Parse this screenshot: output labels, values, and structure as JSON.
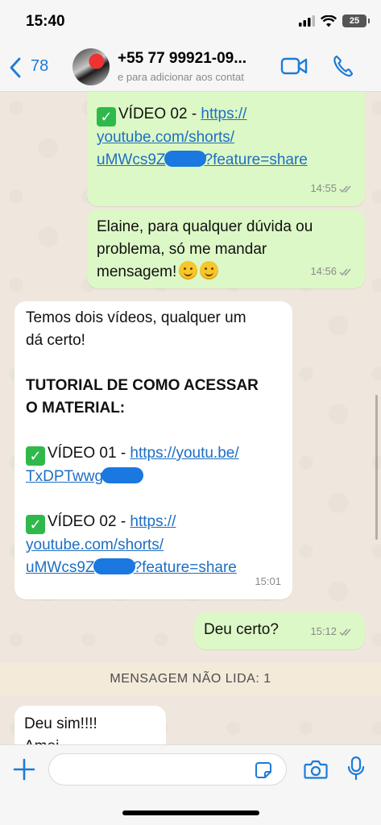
{
  "status_bar": {
    "time": "15:40",
    "battery": "25"
  },
  "header": {
    "back_count": "78",
    "contact_name": "+55 77 99921-09...",
    "contact_subtitle": "e para adicionar aos contat"
  },
  "messages": {
    "m1": {
      "check": "✓",
      "label": "VÍDEO 02 - ",
      "link_a": "https://",
      "link_b": "youtube.com/shorts/",
      "link_c1": "uMWcs9Z",
      "link_c2": "?feature=share",
      "time": "14:55"
    },
    "m2": {
      "line1": "Elaine, para qualquer dúvida ou",
      "line2": "problema, só me mandar",
      "line3": "mensagem!",
      "time": "14:56"
    },
    "m3": {
      "line1": "Temos dois vídeos, qualquer um",
      "line2": "dá certo!",
      "tutorial1": "TUTORIAL DE COMO ACESSAR",
      "tutorial2": "O MATERIAL:",
      "v1_label": "VÍDEO 01 - ",
      "v1_link_a": "https://youtu.be/",
      "v1_link_b": "TxDPTwwg",
      "v2_label": "VÍDEO 02 - ",
      "v2_link_a": "https://",
      "v2_link_b": "youtube.com/shorts/",
      "v2_link_c1": "uMWcs9Z",
      "v2_link_c2": "?feature=share",
      "time": "15:01"
    },
    "m4": {
      "text": "Deu certo?",
      "time": "15:12"
    },
    "unread": "MENSAGEM NÃO LIDA: 1",
    "m5": {
      "line1": "Deu sim!!!!",
      "line2": "Amei"
    }
  },
  "input": {
    "placeholder": ""
  },
  "colors": {
    "outgoing": "#dcf8c6",
    "incoming": "#ffffff",
    "link": "#1e6fc2",
    "accent": "#1d7bd6"
  },
  "icons": [
    "back-chevron-icon",
    "video-call-icon",
    "phone-icon",
    "plus-icon",
    "sticker-icon",
    "camera-icon",
    "mic-icon",
    "read-receipt-icon",
    "check-emoji-icon",
    "smile-emoji-icon"
  ]
}
